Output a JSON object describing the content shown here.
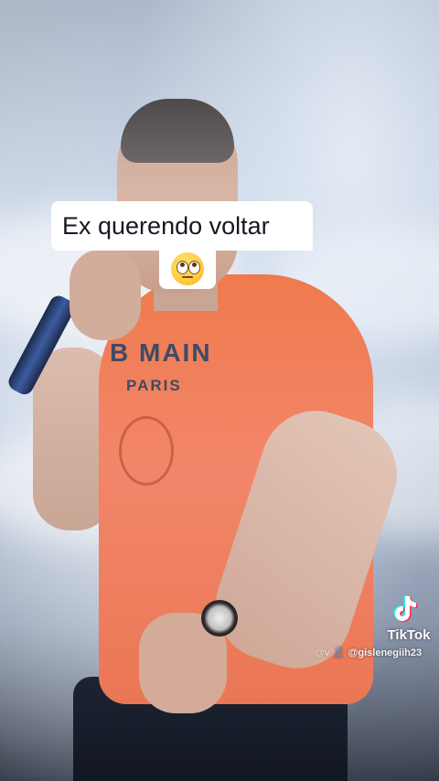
{
  "caption": {
    "line1": "Ex querendo voltar",
    "emoji": "face-with-rolling-eyes"
  },
  "shirt_print": {
    "line1": "B  MAIN",
    "line2": "PARIS"
  },
  "watermark": {
    "brand": "TikTok",
    "logo_icon": "tiktok-note-icon",
    "handle": "@gislenegiih23",
    "handle_prefix_icons": "@v  👤"
  },
  "colors": {
    "caption_bg": "#ffffff",
    "caption_text": "#161823",
    "shirt": "#ef7a4d",
    "tiktok_cyan": "#25f4ee",
    "tiktok_pink": "#fe2c55"
  }
}
